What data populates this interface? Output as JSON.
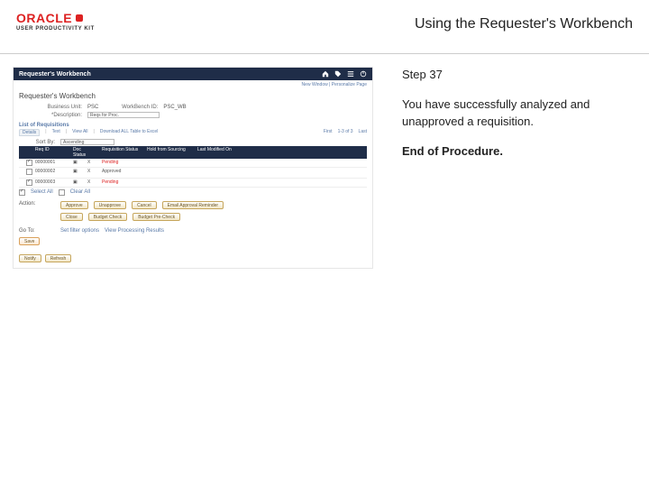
{
  "header": {
    "logo_text": "ORACLE",
    "upk": "USER PRODUCTIVITY KIT",
    "title": "Using the Requester's Workbench"
  },
  "right": {
    "step": "Step 37",
    "msg": "You have successfully analyzed and unapproved a requisition.",
    "end": "End of Procedure."
  },
  "shot": {
    "bar_title": "Requester's Workbench",
    "crumb": "New Window | Personalize Page",
    "h1": "Requester's Workbench",
    "bu_label": "Business Unit:",
    "bu_value": "PSC",
    "wb_label": "WorkBench ID:",
    "wb_value": "PSC_WB",
    "desc_label": "*Description:",
    "desc_value": "Reqs for Proc.",
    "section": "List of Requisitions",
    "tabs": [
      "Details",
      "Text",
      "View All",
      "Download ALL Table to Excel",
      "First",
      "1-3 of 3",
      "Last"
    ],
    "sort_label": "Sort By:",
    "sort_value": "Ascending",
    "cols": [
      "",
      "Req ID",
      "Doc Status",
      "",
      "Requisition Status",
      "Hold from Sourcing",
      "Last Modified On"
    ],
    "rows": [
      {
        "sel": true,
        "id": "00000001",
        "status": "",
        "rstat": "X",
        "req": "Pending"
      },
      {
        "sel": false,
        "id": "00000002",
        "status": "",
        "rstat": "X",
        "req": "Approved"
      },
      {
        "sel": true,
        "id": "00000003",
        "status": "",
        "rstat": "X",
        "req": "Pending"
      }
    ],
    "select_all": "Select All",
    "clear_all": "Clear All",
    "action_label": "Action:",
    "actions1": [
      "Approve",
      "Unapprove",
      "Cancel",
      "Email Approval Reminder"
    ],
    "actions2": [
      "Close",
      "Budget Check",
      "Budget Pre-Check"
    ],
    "goto_label": "Go To:",
    "goto1": "Set filter options",
    "goto2": "View Processing Results",
    "save": "Save",
    "foot1": "Notify",
    "foot2": "Refresh"
  }
}
